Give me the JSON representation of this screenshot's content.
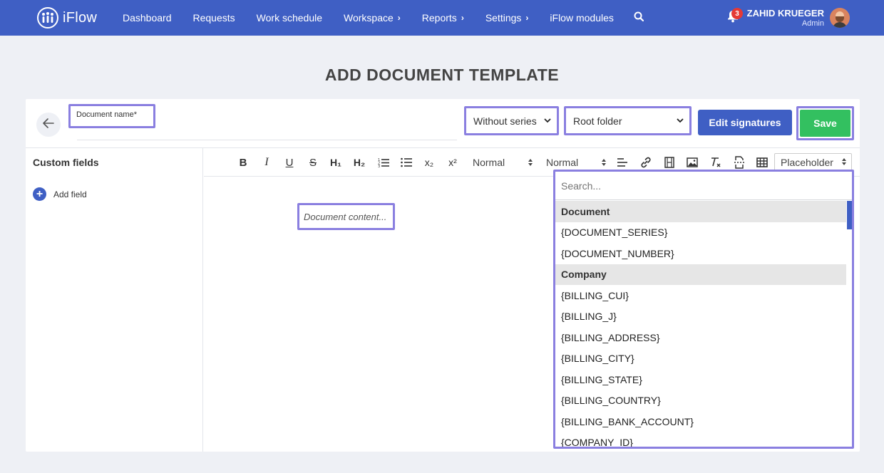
{
  "app": {
    "name": "iFlow"
  },
  "nav": {
    "items": [
      {
        "label": "Dashboard",
        "has_chevron": false
      },
      {
        "label": "Requests",
        "has_chevron": false
      },
      {
        "label": "Work schedule",
        "has_chevron": false
      },
      {
        "label": "Workspace",
        "has_chevron": true
      },
      {
        "label": "Reports",
        "has_chevron": true
      },
      {
        "label": "Settings",
        "has_chevron": true
      },
      {
        "label": "iFlow modules",
        "has_chevron": false
      }
    ],
    "chevron": "›"
  },
  "notifications": {
    "count": "3"
  },
  "user": {
    "name": "ZAHID KRUEGER",
    "role": "Admin"
  },
  "page": {
    "title": "ADD DOCUMENT TEMPLATE"
  },
  "form": {
    "document_name_label": "Document name*",
    "series_select": "Without series",
    "folder_select": "Root folder",
    "edit_signatures_label": "Edit signatures",
    "save_label": "Save"
  },
  "sidebar": {
    "title": "Custom fields",
    "add_field_label": "Add field"
  },
  "toolbar": {
    "bold": "B",
    "italic": "I",
    "underline": "U",
    "strike": "S",
    "h1": "H₁",
    "h2": "H₂",
    "subscript": "x₂",
    "superscript": "x²",
    "font_size_select": "Normal",
    "font_family_select": "Normal",
    "placeholder_select": "Placeholder"
  },
  "editor": {
    "content_placeholder": "Document content..."
  },
  "placeholder_dropdown": {
    "search_placeholder": "Search...",
    "groups": [
      {
        "label": "Document",
        "items": [
          "{DOCUMENT_SERIES}",
          "{DOCUMENT_NUMBER}"
        ]
      },
      {
        "label": "Company",
        "items": [
          "{BILLING_CUI}",
          "{BILLING_J}",
          "{BILLING_ADDRESS}",
          "{BILLING_CITY}",
          "{BILLING_STATE}",
          "{BILLING_COUNTRY}",
          "{BILLING_BANK_ACCOUNT}",
          "{COMPANY_ID}"
        ]
      }
    ]
  },
  "colors": {
    "brand": "#3f5fc4",
    "save": "#33c060",
    "highlight": "#8a7fe0",
    "badge": "#e53935"
  }
}
